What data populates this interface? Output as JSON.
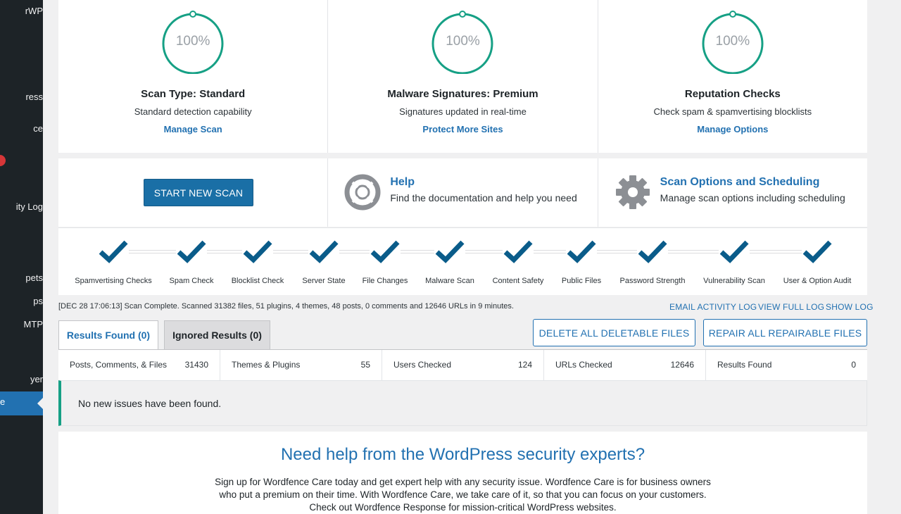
{
  "sidebar": {
    "items": [
      {
        "label": "rWP"
      },
      {
        "label": "ress"
      },
      {
        "label": "ce"
      },
      {
        "label": "ity Log"
      },
      {
        "label": "pets"
      },
      {
        "label": "ps"
      },
      {
        "label": "MTP"
      },
      {
        "label": "yer"
      },
      {
        "label": "e"
      }
    ]
  },
  "top_cards": [
    {
      "percent": "100%",
      "title": "Scan Type: Standard",
      "desc": "Standard detection capability",
      "link": "Manage Scan"
    },
    {
      "percent": "100%",
      "title": "Malware Signatures: Premium",
      "desc": "Signatures updated in real-time",
      "link": "Protect More Sites"
    },
    {
      "percent": "100%",
      "title": "Reputation Checks",
      "desc": "Check spam & spamvertising blocklists",
      "link": "Manage Options"
    }
  ],
  "actions": {
    "start_scan": "START NEW SCAN",
    "help_title": "Help",
    "help_desc": "Find the documentation and help you need",
    "options_title": "Scan Options and Scheduling",
    "options_desc": "Manage scan options including scheduling"
  },
  "steps": [
    "Spamvertising Checks",
    "Spam Check",
    "Blocklist Check",
    "Server State",
    "File Changes",
    "Malware Scan",
    "Content Safety",
    "Public Files",
    "Password Strength",
    "Vulnerability Scan",
    "User & Option Audit"
  ],
  "status": {
    "text": "[DEC 28 17:06:13] Scan Complete. Scanned 31382 files, 51 plugins, 4 themes, 48 posts, 0 comments and 12646 URLs in 9 minutes.",
    "email_log": "EMAIL ACTIVITY LOG",
    "full_log": "VIEW FULL LOG",
    "show_log": "SHOW LOG"
  },
  "tabs": {
    "found": "Results Found (0)",
    "ignored": "Ignored Results (0)"
  },
  "buttons": {
    "delete_all": "DELETE ALL DELETABLE FILES",
    "repair_all": "REPAIR ALL REPAIRABLE FILES"
  },
  "stats": [
    {
      "label": "Posts, Comments, & Files",
      "value": "31430"
    },
    {
      "label": "Themes & Plugins",
      "value": "55"
    },
    {
      "label": "Users Checked",
      "value": "124"
    },
    {
      "label": "URLs Checked",
      "value": "12646"
    },
    {
      "label": "Results Found",
      "value": "0"
    }
  ],
  "results_message": "No new issues have been found.",
  "promo": {
    "title": "Need help from the WordPress security experts?",
    "body": "Sign up for Wordfence Care today and get expert help with any security issue. Wordfence Care is for business owners who put a premium on their time. With Wordfence Care, we take care of it, so that you can focus on your customers. Check out Wordfence Response for mission-critical WordPress websites."
  },
  "colors": {
    "accent": "#2271b1",
    "ring": "#16a085",
    "check": "#0a5c8a",
    "sidebar": "#1d2327"
  }
}
